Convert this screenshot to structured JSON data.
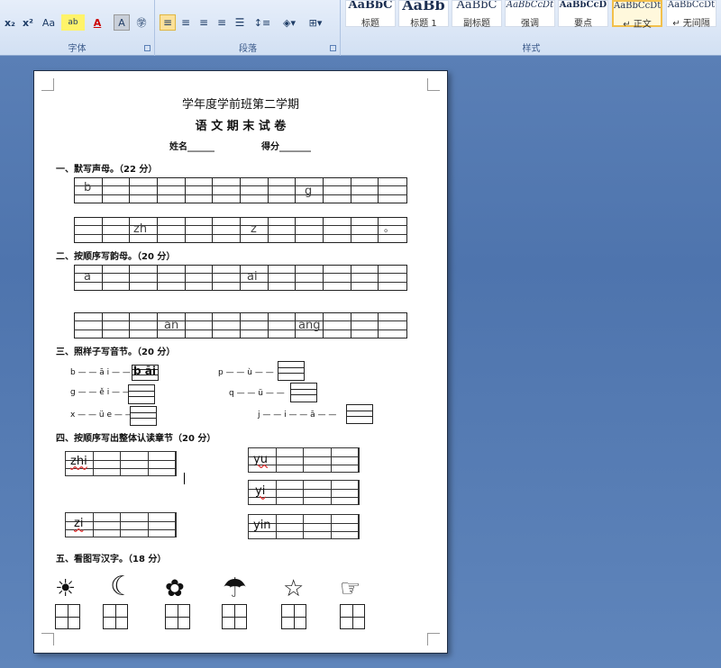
{
  "ribbon": {
    "font_group_label": "字体",
    "paragraph_group_label": "段落",
    "styles_group_label": "样式",
    "font_buttons": [
      "x₂",
      "x²",
      "Aa",
      "ab",
      "A",
      "A",
      "㊫"
    ],
    "styles": [
      {
        "preview": "AaBbC",
        "label": "标题"
      },
      {
        "preview": "AaBb",
        "label": "标题 1"
      },
      {
        "preview": "AaBbC",
        "label": "副标题"
      },
      {
        "preview": "AaBbCcDt",
        "label": "强调"
      },
      {
        "preview": "AaBbCcD",
        "label": "要点"
      },
      {
        "preview": "AaBbCcDt",
        "label": "↵ 正文"
      },
      {
        "preview": "AaBbCcDt",
        "label": "↵ 无间隔"
      }
    ]
  },
  "doc": {
    "title": "学年度学前班第二学期",
    "subtitle": "语 文 期 末 试 卷",
    "name_label": "姓名______",
    "score_label": "得分_______",
    "sections": {
      "s1": "一、默写声母。（22 分）",
      "s2": "二、按顺序写韵母。（20 分）",
      "s3": "三、照样子写音节。（20 分）",
      "s4": "四、按顺序写出整体认读章节（20 分）",
      "s5": "五、看图写汉字。（18 分）"
    },
    "s1_row1": {
      "b": "b",
      "g": "g"
    },
    "s1_row2": {
      "zh": "zh",
      "z": "z",
      "dot": "。"
    },
    "s2_row1": {
      "a": "a",
      "ai": "ai"
    },
    "s2_row2": {
      "an": "an",
      "ang": "ang"
    },
    "s3": {
      "ex1": "b — — ā i — —",
      "ans1": "b āi",
      "ex2": "p — — ù — —",
      "ex3": "g — — ě i — —",
      "ex4": "q — — ü — —",
      "ex5": "x — — ü e — —",
      "ex6": "j — — i — — ā — —"
    },
    "s4": {
      "zhi": "zhi",
      "yu": "yu",
      "yi": "yi",
      "zi": "zi",
      "yin": "yin"
    },
    "s5_icons": [
      "sun-icon",
      "moon-icon",
      "flower-icon",
      "umbrella-icon",
      "star-icon",
      "hand-icon"
    ],
    "s5_glyphs": [
      "☀",
      "☾",
      "✿",
      "☂",
      "☆",
      "☞"
    ]
  }
}
